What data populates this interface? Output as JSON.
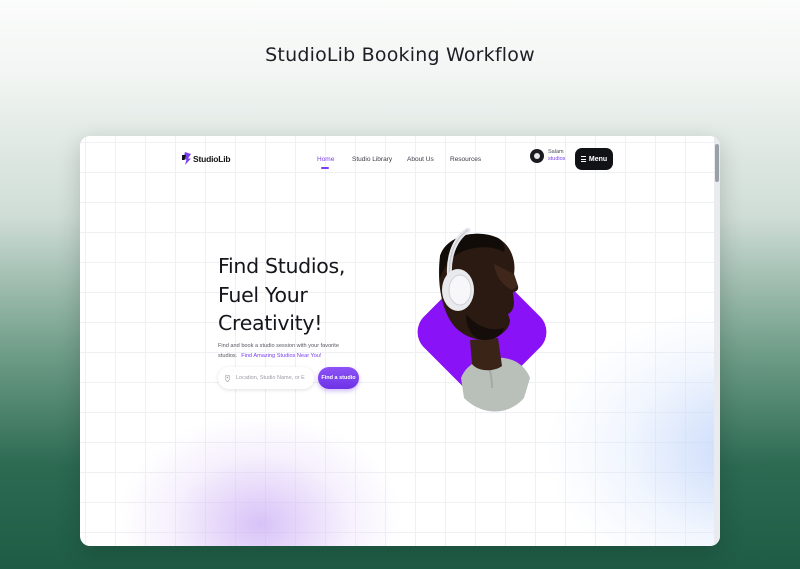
{
  "page": {
    "heading": "StudioLib Booking Workflow"
  },
  "brand": {
    "name": "StudioLib",
    "accent": "#7b3ff2"
  },
  "nav": {
    "links": [
      {
        "label": "Home",
        "active": true
      },
      {
        "label": "Studio Library",
        "active": false
      },
      {
        "label": "About Us",
        "active": false
      },
      {
        "label": "Resources",
        "active": false
      }
    ],
    "user": {
      "name": "Salam",
      "subtitle": "studios"
    },
    "menu_label": "Menu"
  },
  "hero": {
    "title_lines": [
      "Find Studios,",
      "Fuel Your",
      "Creativity!"
    ],
    "subtitle": "Find and book a studio session with your favorite studios.",
    "link_text": "Find Amazing Studios Near You!",
    "search": {
      "placeholder": "Location, Studio Name, or E",
      "icon": "location-pin-icon"
    },
    "cta_label": "Find a studio",
    "image": "man-with-headphones"
  }
}
